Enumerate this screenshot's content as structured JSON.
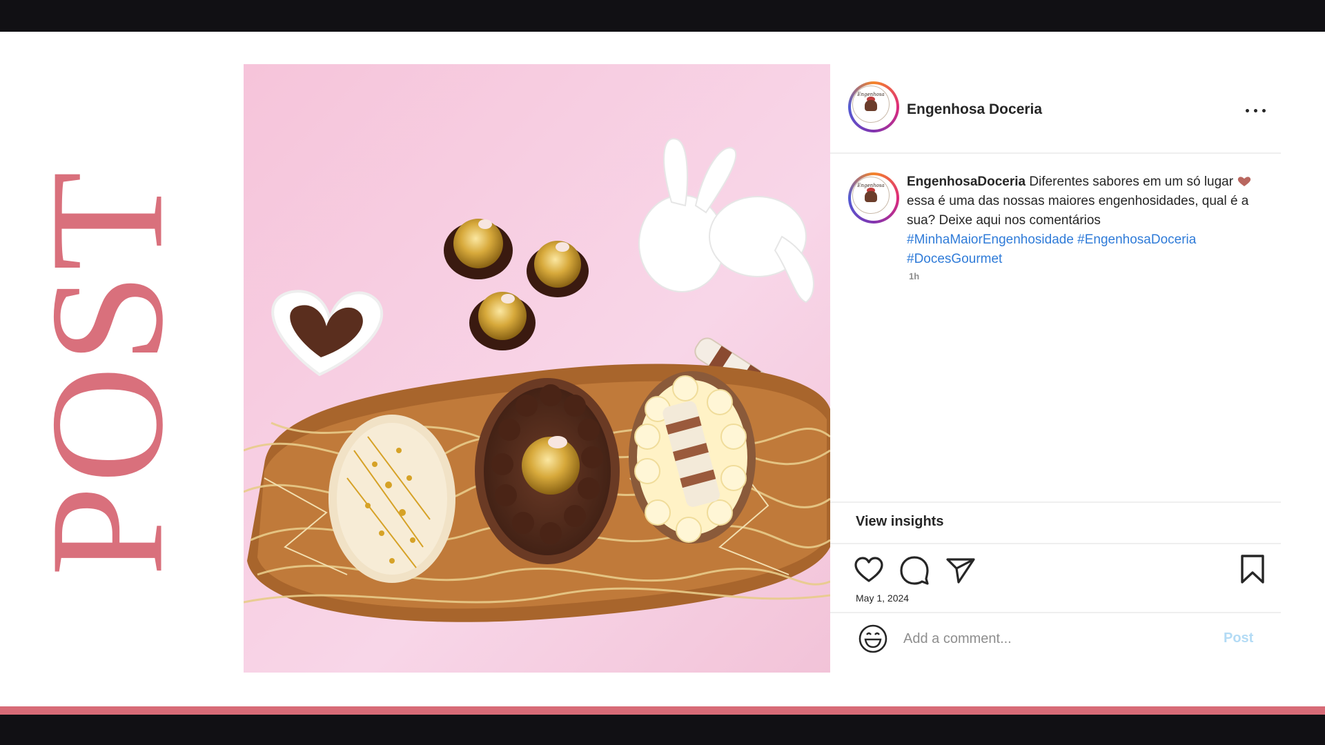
{
  "slide": {
    "title": "POST",
    "accent_color": "#d9707c"
  },
  "photo": {
    "description_icon": "food-photo"
  },
  "post": {
    "account_name": "Engenhosa Doceria",
    "avatar_logo_text": "Engenhosa",
    "caption": {
      "username": "EngenhosaDoceria",
      "text": "Diferentes sabores em um só lugar",
      "text_continued": "essa é uma das nossas maiores engenhosidades, qual é a sua? Deixe aqui nos comentários",
      "hashtags": "#MinhaMaiorEngenhosidade #EngenhosaDoceria #DocesGourmet",
      "emoji": "heart-icon"
    },
    "time_ago": "1h",
    "insights_label": "View insights",
    "date": "May 1, 2024",
    "comment_placeholder": "Add a comment...",
    "post_button": "Post",
    "hashtag_color": "#2f7bd8"
  }
}
